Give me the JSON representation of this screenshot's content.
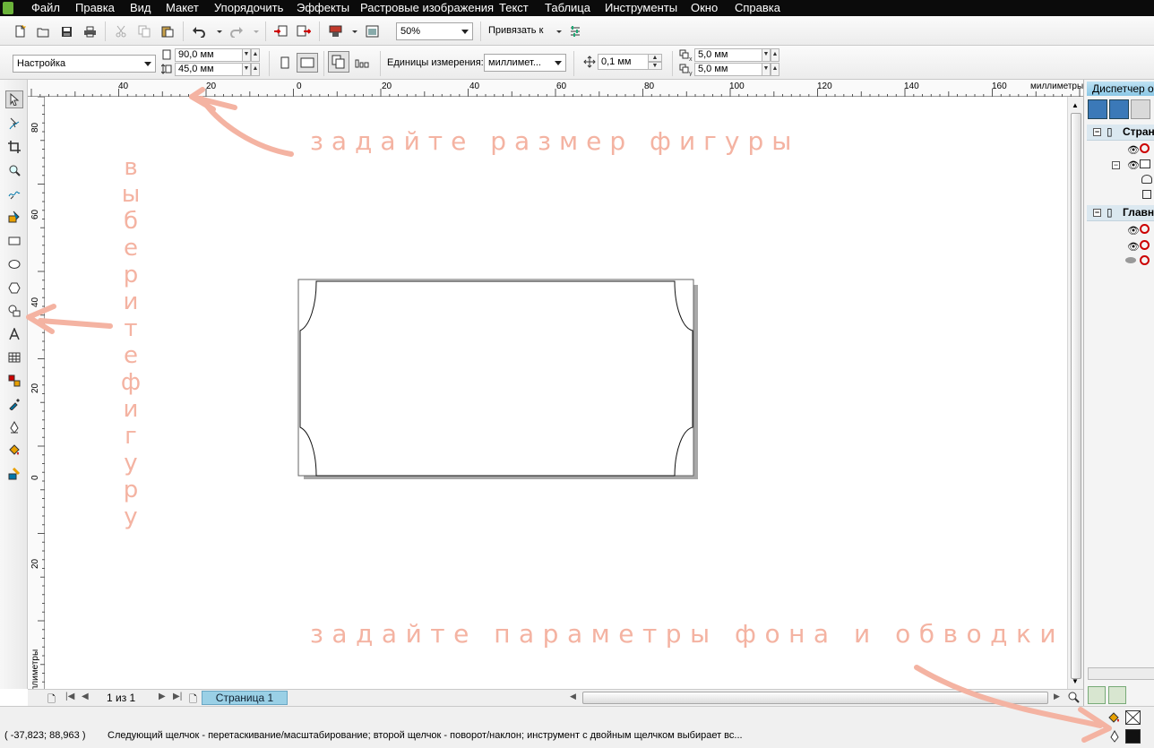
{
  "menu": [
    "Файл",
    "Правка",
    "Вид",
    "Макет",
    "Упорядочить",
    "Эффекты",
    "Растровые изображения",
    "Текст",
    "Таблица",
    "Инструменты",
    "Окно",
    "Справка"
  ],
  "toolbar": {
    "zoom_value": "50%",
    "snap_label": "Привязать к"
  },
  "property_bar": {
    "preset_value": "Настройка",
    "width_value": "90,0 мм",
    "height_value": "45,0 мм",
    "units_label": "Единицы измерения:",
    "units_value": "миллимет...",
    "nudge_value": "0,1 мм",
    "dup_x_value": "5,0 мм",
    "dup_y_value": "5,0 мм"
  },
  "ruler": {
    "h_labels": [
      "40",
      "20",
      "0",
      "20",
      "40",
      "60",
      "80",
      "100",
      "120",
      "140",
      "160"
    ],
    "h_units": "миллиметры",
    "v_labels": [
      "80",
      "60",
      "40",
      "20",
      "0",
      "20"
    ],
    "v_units": "миллиметры"
  },
  "page_nav": {
    "counter": "1 из 1",
    "tab_label": "Страница 1"
  },
  "docker": {
    "title": "Диспетчер о",
    "page_row": "Страни",
    "master_row": "Главн"
  },
  "status": {
    "coords": "( -37,823; 88,963 )",
    "hint": "Следующий щелчок - перетаскивание/масштабирование; второй щелчок - поворот/наклон; инструмент с двойным щелчком выбирает вс..."
  },
  "annotations": {
    "size_hint": "задайте размер фигуры",
    "shape_hint_vertical": "выберите фигуру",
    "fill_hint": "задайте параметры фона и обводки"
  },
  "colors": {
    "annotation": "#f4b3a2",
    "page_tab": "#9ad0e6",
    "menubar": "#0b0b0b"
  }
}
